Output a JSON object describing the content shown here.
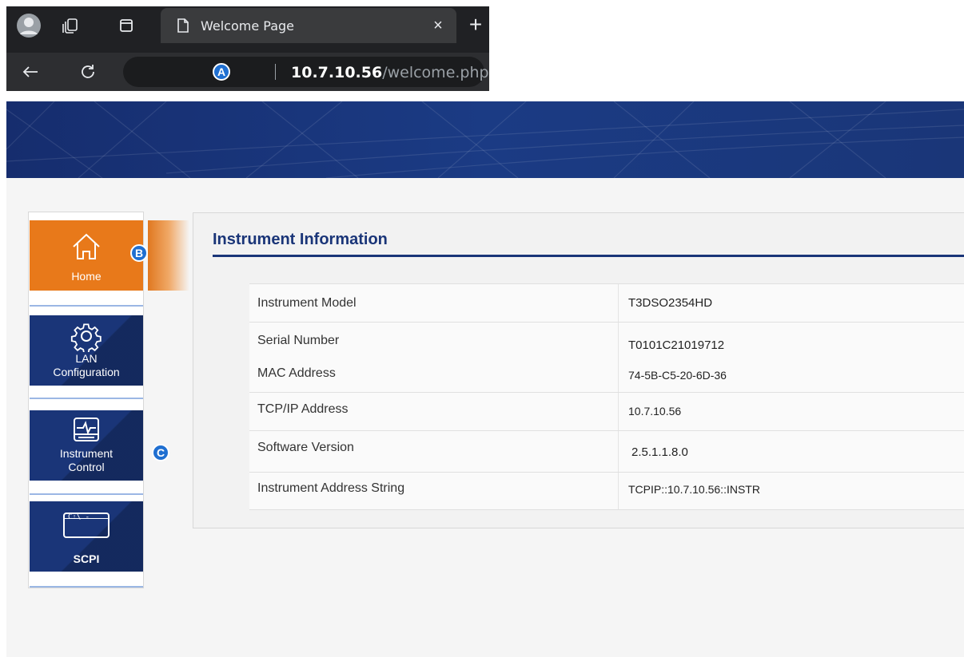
{
  "browser": {
    "tab_title": "Welcome Page",
    "tab_close": "×",
    "new_tab": "+",
    "url_host": "10.7.10.56",
    "url_path": "/welcome.php",
    "markers": {
      "a": "A",
      "b": "B",
      "c": "C"
    }
  },
  "sidenav": {
    "items": [
      {
        "label": "Home",
        "icon": "home-icon",
        "active": true
      },
      {
        "label": "LAN Configuration",
        "label_line1": "LAN",
        "label_line2": "Configuration",
        "icon": "gear-icon"
      },
      {
        "label_line1": "Instrument",
        "label_line2": "Control",
        "icon": "monitor-pulse-icon"
      },
      {
        "label": "SCPI",
        "icon": "terminal-icon",
        "icon_text": "C:\\ -"
      }
    ]
  },
  "panel": {
    "title": "Instrument Information",
    "rows": [
      {
        "key": "Instrument Model",
        "value": "T3DSO2354HD"
      },
      {
        "key": "Serial Number",
        "value": "T0101C21019712"
      },
      {
        "key": "MAC Address",
        "value": "74-5B-C5-20-6D-36"
      },
      {
        "key": "TCP/IP Address",
        "value": "10.7.10.56"
      },
      {
        "key": "Software Version",
        "value": "2.5.1.1.8.0"
      },
      {
        "key": "Instrument Address String",
        "value": "TCPIP::10.7.10.56::INSTR"
      }
    ]
  },
  "colors": {
    "brand_blue": "#1a3578",
    "active_orange": "#e8791a",
    "marker_blue": "#1f6fd1"
  }
}
